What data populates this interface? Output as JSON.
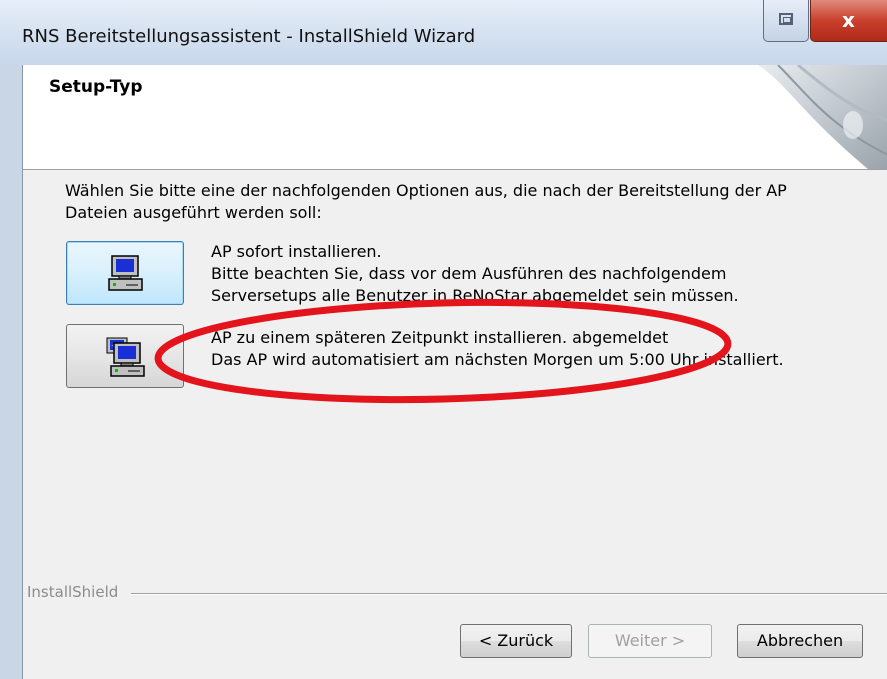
{
  "window": {
    "title": "RNS Bereitstellungsassistent - InstallShield Wizard"
  },
  "titlebar_buttons": {
    "restore_icon": "restore-icon",
    "close_glyph": "x"
  },
  "header": {
    "title": "Setup-Typ"
  },
  "intro_text": [
    "Wählen Sie bitte eine der nachfolgenden Optionen aus, die nach der Bereitstellung der AP",
    "Dateien ausgeführt werden soll:"
  ],
  "options": [
    {
      "icon": "computer-icon",
      "lines": [
        "AP sofort installieren.",
        "Bitte beachten Sie, dass vor dem Ausführen des nachfolgendem",
        "Serversetups alle Benutzer in ReNoStar abgemeldet sein müssen."
      ]
    },
    {
      "icon": "scheduled-computer-icon",
      "lines": [
        "AP zu einem späteren Zeitpunkt installieren. abgemeldet",
        "Das AP wird automatisiert am nächsten Morgen um 5:00 Uhr installiert."
      ]
    }
  ],
  "annotation": {
    "type": "red ellipse",
    "color": "#e3141b"
  },
  "footer": {
    "brand": "InstallShield",
    "back_label": "< Zurück",
    "next_label": "Weiter >",
    "cancel_label": "Abbrechen"
  },
  "colors": {
    "title_bar": "#d6e2f1",
    "close_button": "#c9402c",
    "dialog_background": "#f0f0f0",
    "focus_border": "#3c7fb1"
  }
}
